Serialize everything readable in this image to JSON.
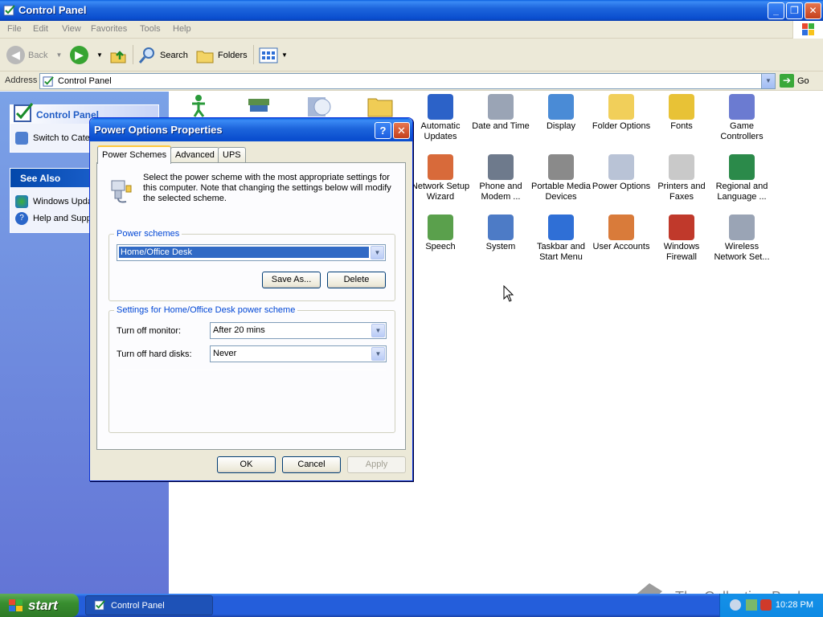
{
  "window": {
    "title": "Control Panel",
    "buttons": {
      "minimize": "_",
      "maximize": "❐",
      "close": "✕"
    }
  },
  "menubar": [
    "File",
    "Edit",
    "View",
    "Favorites",
    "Tools",
    "Help"
  ],
  "toolbar": {
    "back": "Back",
    "search": "Search",
    "folders": "Folders"
  },
  "address": {
    "label": "Address",
    "value": "Control Panel",
    "go": "Go"
  },
  "leftpane": {
    "control_panel": {
      "title": "Control Panel",
      "switch": "Switch to Category View"
    },
    "see_also": {
      "title": "See Also",
      "items": [
        "Windows Update",
        "Help and Support"
      ]
    }
  },
  "icons": [
    {
      "label": "Automatic Updates",
      "icon": "shield-globe-icon",
      "color": "#2c62c8"
    },
    {
      "label": "Date and Time",
      "icon": "clock-icon",
      "color": "#9aa4b5"
    },
    {
      "label": "Display",
      "icon": "monitor-icon",
      "color": "#4a8bd6"
    },
    {
      "label": "Folder Options",
      "icon": "folder-icon",
      "color": "#f1cf5a"
    },
    {
      "label": "Fonts",
      "icon": "fonts-folder-icon",
      "color": "#e8c236"
    },
    {
      "label": "Game Controllers",
      "icon": "gamepad-icon",
      "color": "#6b7bd1"
    },
    {
      "label": "Network Setup Wizard",
      "icon": "house-network-icon",
      "color": "#d86a3a"
    },
    {
      "label": "Phone and Modem ...",
      "icon": "phone-icon",
      "color": "#6e7a8c"
    },
    {
      "label": "Portable Media Devices",
      "icon": "media-device-icon",
      "color": "#8a8a8a"
    },
    {
      "label": "Power Options",
      "icon": "power-plug-icon",
      "color": "#b9c3d6"
    },
    {
      "label": "Printers and Faxes",
      "icon": "printer-icon",
      "color": "#c9c9c9"
    },
    {
      "label": "Regional and Language ...",
      "icon": "globe-icon",
      "color": "#2b8a4a"
    },
    {
      "label": "Speech",
      "icon": "speech-icon",
      "color": "#5aa04c"
    },
    {
      "label": "System",
      "icon": "computer-icon",
      "color": "#4d7bc6"
    },
    {
      "label": "Taskbar and Start Menu",
      "icon": "taskbar-icon",
      "color": "#2f6fd6"
    },
    {
      "label": "User Accounts",
      "icon": "users-icon",
      "color": "#d97b3a"
    },
    {
      "label": "Windows Firewall",
      "icon": "firewall-icon",
      "color": "#c0392b"
    },
    {
      "label": "Wireless Network Set...",
      "icon": "wireless-icon",
      "color": "#9aa4b5"
    }
  ],
  "dialog": {
    "title": "Power Options Properties",
    "help": "?",
    "close": "✕",
    "tabs": [
      "Power Schemes",
      "Advanced",
      "UPS"
    ],
    "description": "Select the power scheme with the most appropriate settings for this computer. Note that changing the settings below will modify the selected scheme.",
    "schemes_group": "Power schemes",
    "scheme_value": "Home/Office Desk",
    "save_as": "Save As...",
    "delete": "Delete",
    "settings_group": "Settings for Home/Office Desk power scheme",
    "monitor_label": "Turn off monitor:",
    "monitor_value": "After 20 mins",
    "disks_label": "Turn off hard disks:",
    "disks_value": "Never",
    "ok": "OK",
    "cancel": "Cancel",
    "apply": "Apply"
  },
  "taskbar": {
    "start": "start",
    "task": "Control Panel",
    "clock": "10:28 PM"
  },
  "watermark": "The Collection Book"
}
